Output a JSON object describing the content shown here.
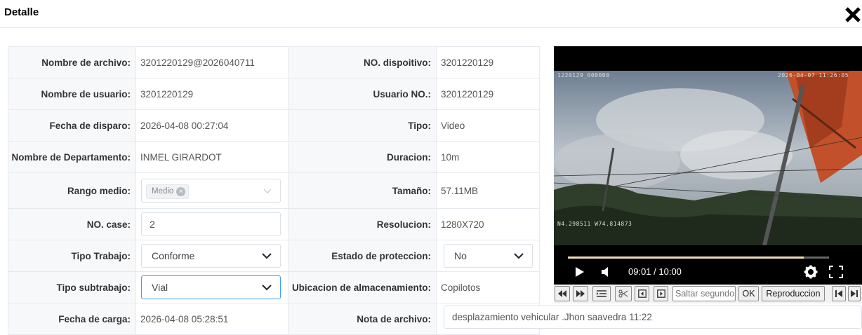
{
  "dialog": {
    "title": "Detalle",
    "close_icon": "close-icon"
  },
  "fields": {
    "nombre_archivo": {
      "label": "Nombre de archivo:",
      "value": "3201220129@2026040711"
    },
    "no_dispositivo": {
      "label": "NO. dispoitivo:",
      "value": "3201220129"
    },
    "nombre_usuario": {
      "label": "Nombre de usuario:",
      "value": "3201220129"
    },
    "usuario_no": {
      "label": "Usuario NO.:",
      "value": "3201220129"
    },
    "fecha_disparo": {
      "label": "Fecha de disparo:",
      "value": "2026-04-08 00:27:04"
    },
    "tipo": {
      "label": "Tipo:",
      "value": "Video"
    },
    "departamento": {
      "label": "Nombre de Departamento:",
      "value": "INMEL GIRARDOT"
    },
    "duracion": {
      "label": "Duracion:",
      "value": "10m"
    },
    "rango_medio": {
      "label": "Rango medio:",
      "tag": "Medio"
    },
    "tamano": {
      "label": "Tamaño:",
      "value": "57.11MB"
    },
    "no_case": {
      "label": "NO. case:",
      "value": "2"
    },
    "resolucion": {
      "label": "Resolucion:",
      "value": "1280X720"
    },
    "tipo_trabajo": {
      "label": "Tipo Trabajo:",
      "value": "Conforme"
    },
    "estado_proteccion": {
      "label": "Estado de proteccion:",
      "value": "No"
    },
    "tipo_subtrabajo": {
      "label": "Tipo subtrabajo:",
      "value": "Vial"
    },
    "ubicacion": {
      "label": "Ubicacion de almacenamiento:",
      "value": "Copilotos"
    },
    "fecha_carga": {
      "label": "Fecha de carga:",
      "value": "2026-04-08 05:28:51"
    },
    "nota_archivo": {
      "label": "Nota de archivo:",
      "value": "desplazamiento vehicular .Jhon saavedra 11:22"
    }
  },
  "video": {
    "osd_top_left": "1220129_000000",
    "osd_top_right": "2026-04-07 11:26:05",
    "osd_gps": "N4.298511 W74.814873",
    "time": "09:01 / 10:00",
    "progress": 0.902
  },
  "toolbar": {
    "seek_placeholder": "Saltar segundos",
    "ok_label": "OK",
    "playback_label": "Reproduccion"
  }
}
